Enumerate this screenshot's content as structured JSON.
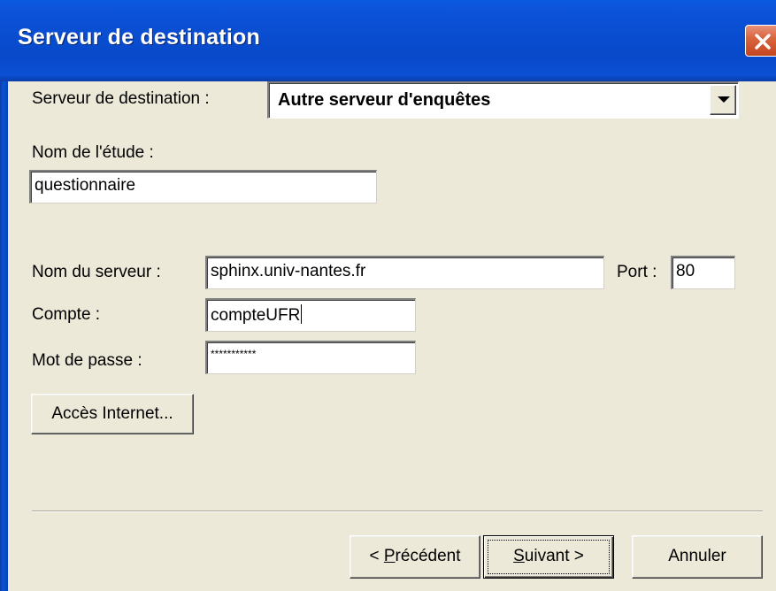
{
  "window": {
    "title": "Serveur de destination"
  },
  "form": {
    "destination_label": "Serveur de destination :",
    "destination_value": "Autre serveur d'enquêtes",
    "study_name_label": "Nom de l'étude :",
    "study_name_value": "questionnaire",
    "server_name_label": "Nom du serveur :",
    "server_name_value": "sphinx.univ-nantes.fr",
    "port_label": "Port :",
    "port_value": "80",
    "account_label": "Compte :",
    "account_value": "compteUFR",
    "password_label": "Mot de passe :",
    "password_value": "***********",
    "internet_access_button": "Accès Internet..."
  },
  "footer": {
    "previous_prefix": "< ",
    "previous_mnemonic": "P",
    "previous_rest": "récédent",
    "next_mnemonic": "S",
    "next_rest": "uivant >",
    "cancel_label": "Annuler"
  },
  "colors": {
    "titlebar": "#0a4fd4",
    "close_button": "#d9663f",
    "dialog_background": "#ece9d8"
  },
  "icons": {
    "close": "close-icon",
    "dropdown": "chevron-down-icon"
  }
}
